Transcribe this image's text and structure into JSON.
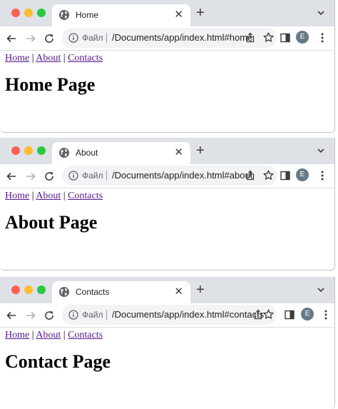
{
  "windows": [
    {
      "tab_title": "Home",
      "file_label": "Файл",
      "url": "/Documents/app/index.html#home",
      "avatar_letter": "E",
      "nav": {
        "home": "Home",
        "about": "About",
        "contacts": "Contacts",
        "separator": "|"
      },
      "heading": "Home Page"
    },
    {
      "tab_title": "About",
      "file_label": "Файл",
      "url": "/Documents/app/index.html#about",
      "avatar_letter": "E",
      "nav": {
        "home": "Home",
        "about": "About",
        "contacts": "Contacts",
        "separator": "|"
      },
      "heading": "About Page"
    },
    {
      "tab_title": "Contacts",
      "file_label": "Файл",
      "url": "/Documents/app/index.html#contacts",
      "avatar_letter": "E",
      "nav": {
        "home": "Home",
        "about": "About",
        "contacts": "Contacts",
        "separator": "|"
      },
      "heading": "Contact Page"
    }
  ],
  "icons": {
    "tab_favicon": "globe-icon",
    "tab_close": "close-icon",
    "new_tab": "plus-icon",
    "tab_search": "chevron-down-icon",
    "back": "arrow-left-icon",
    "forward": "arrow-right-icon",
    "reload": "reload-icon",
    "site_info": "info-icon",
    "share": "share-icon",
    "bookmark": "star-icon",
    "side_panel": "side-panel-icon",
    "menu": "kebab-menu-icon"
  },
  "colors": {
    "tabstrip": "#dee1e6",
    "omnibox": "#f1f3f4",
    "link": "#551a8b",
    "avatar": "#667b86",
    "close_dot": "#ff5f57",
    "minimize_dot": "#febc2e",
    "zoom_dot": "#28c840"
  }
}
